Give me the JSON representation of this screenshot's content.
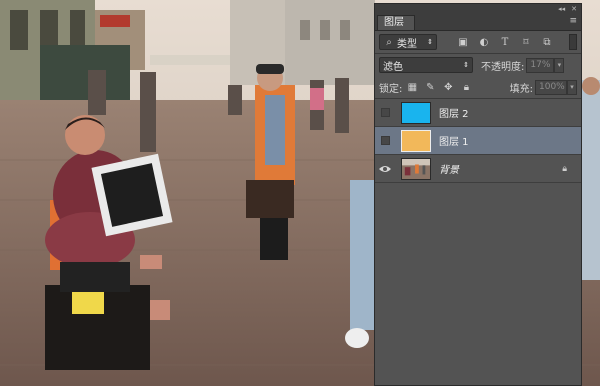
{
  "panel": {
    "tab_label": "图层",
    "collapse_glyph": "◂◂",
    "close_glyph": "✕",
    "menu_glyph": "≡",
    "filter": {
      "label": "类型",
      "icons": [
        "pixel-filter-icon",
        "adjustment-filter-icon",
        "type-filter-icon",
        "shape-filter-icon",
        "smart-object-filter-icon"
      ]
    },
    "blend_mode": "滤色",
    "opacity_label": "不透明度:",
    "opacity_value": "17%",
    "lock_label": "锁定:",
    "fill_label": "填充:",
    "fill_value": "100%",
    "layers": [
      {
        "name": "图层 2",
        "color": "#19b4ee",
        "visible": false,
        "selected": false,
        "italic": false
      },
      {
        "name": "图层 1",
        "color": "#f2b85a",
        "visible": false,
        "selected": true,
        "italic": false
      },
      {
        "name": "背景",
        "color": "photo",
        "visible": true,
        "selected": false,
        "italic": true,
        "locked": true
      }
    ]
  }
}
